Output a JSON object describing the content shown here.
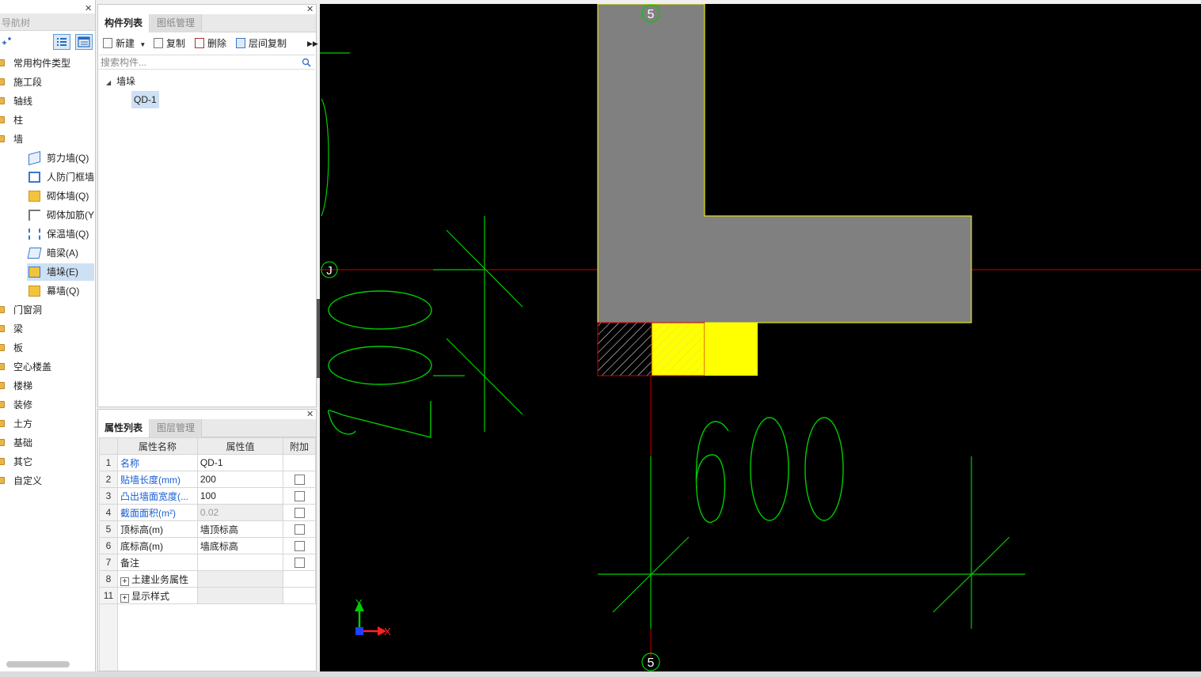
{
  "nav": {
    "title": "导航树",
    "items": [
      {
        "label": "常用构件类型"
      },
      {
        "label": "施工段"
      },
      {
        "label": "轴线"
      },
      {
        "label": "柱"
      },
      {
        "label": "墙"
      },
      {
        "label": "门窗洞"
      },
      {
        "label": "梁"
      },
      {
        "label": "板"
      },
      {
        "label": "空心楼盖"
      },
      {
        "label": "楼梯"
      },
      {
        "label": "装修"
      },
      {
        "label": "土方"
      },
      {
        "label": "基础"
      },
      {
        "label": "其它"
      },
      {
        "label": "自定义"
      }
    ],
    "wall_children": [
      {
        "label": "剪力墙(Q)",
        "icon": "shear-wall-icon"
      },
      {
        "label": "人防门框墙",
        "icon": "door-frame-wall-icon"
      },
      {
        "label": "砌体墙(Q)",
        "icon": "masonry-wall-icon"
      },
      {
        "label": "砌体加筋(Y",
        "icon": "masonry-rebar-icon"
      },
      {
        "label": "保温墙(Q)",
        "icon": "insulation-wall-icon"
      },
      {
        "label": "暗梁(A)",
        "icon": "hidden-beam-icon"
      },
      {
        "label": "墙垛(E)",
        "icon": "wall-pier-icon",
        "selected": true
      },
      {
        "label": "幕墙(Q)",
        "icon": "curtain-wall-icon"
      }
    ]
  },
  "component_panel": {
    "tabs": [
      {
        "label": "构件列表",
        "active": true
      },
      {
        "label": "图纸管理",
        "active": false
      }
    ],
    "toolbar": {
      "new": "新建",
      "copy": "复制",
      "delete": "删除",
      "floor_copy": "层间复制"
    },
    "search_placeholder": "搜索构件...",
    "tree": {
      "group": "墙垛",
      "items": [
        {
          "label": "QD-1",
          "selected": true
        }
      ]
    }
  },
  "property_panel": {
    "tabs": [
      {
        "label": "属性列表",
        "active": true
      },
      {
        "label": "图层管理",
        "active": false
      }
    ],
    "headers": {
      "name": "属性名称",
      "value": "属性值",
      "extra": "附加"
    },
    "rows": [
      {
        "no": "1",
        "name": "名称",
        "value": "QD-1",
        "blue": true,
        "checkbox": false
      },
      {
        "no": "2",
        "name": "贴墙长度(mm)",
        "value": "200",
        "blue": true,
        "checkbox": true
      },
      {
        "no": "3",
        "name": "凸出墙面宽度(...",
        "value": "100",
        "blue": true,
        "checkbox": true
      },
      {
        "no": "4",
        "name": "截面面积(m²)",
        "value": "0.02",
        "blue": true,
        "checkbox": true,
        "readonly": true
      },
      {
        "no": "5",
        "name": "顶标高(m)",
        "value": "墙顶标高",
        "blue": false,
        "checkbox": true
      },
      {
        "no": "6",
        "name": "底标高(m)",
        "value": "墙底标高",
        "blue": false,
        "checkbox": true
      },
      {
        "no": "7",
        "name": "备注",
        "value": "",
        "blue": false,
        "checkbox": true
      },
      {
        "no": "8",
        "name": "土建业务属性",
        "value": "",
        "expander": true
      },
      {
        "no": "11",
        "name": "显示样式",
        "value": "",
        "expander": true
      }
    ]
  },
  "canvas": {
    "axis_labels": {
      "top": "5",
      "bottom": "5",
      "left": "J"
    },
    "dimensions": {
      "vertical": "200",
      "horizontal": "600"
    },
    "ucs": {
      "x": "X",
      "y": "Y"
    },
    "colors": {
      "background": "#000000",
      "wall": "#808080",
      "pier": "#ffff00",
      "dimension": "#00cc00",
      "axis": "#cc0000"
    }
  }
}
